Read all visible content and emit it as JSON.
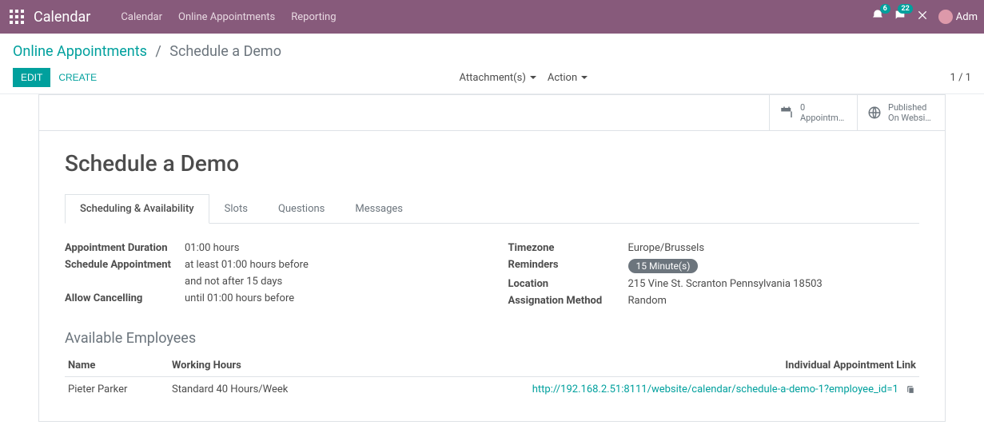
{
  "nav": {
    "brand": "Calendar",
    "links": [
      "Calendar",
      "Online Appointments",
      "Reporting"
    ],
    "notif_count1": "6",
    "notif_count2": "22",
    "user_name": "Adm"
  },
  "breadcrumb": {
    "parent": "Online Appointments",
    "current": "Schedule a Demo"
  },
  "buttons": {
    "edit": "Edit",
    "create": "Create",
    "attachments": "Attachment(s)",
    "action": "Action"
  },
  "pager": "1 / 1",
  "stat_buttons": {
    "appointments_count": "0",
    "appointments_label": "Appointme…",
    "published_label1": "Published",
    "published_label2": "On Websi…"
  },
  "form": {
    "title": "Schedule a Demo",
    "tabs": [
      "Scheduling & Availability",
      "Slots",
      "Questions",
      "Messages"
    ],
    "left": {
      "duration_label": "Appointment Duration",
      "duration_value": "01:00 hours",
      "schedule_label": "Schedule Appointment",
      "schedule_value1": "at least 01:00 hours before",
      "schedule_value2": "and not after 15 days",
      "cancel_label": "Allow Cancelling",
      "cancel_value": "until 01:00 hours before"
    },
    "right": {
      "timezone_label": "Timezone",
      "timezone_value": "Europe/Brussels",
      "reminders_label": "Reminders",
      "reminders_value": "15 Minute(s)",
      "location_label": "Location",
      "location_value": "215 Vine St. Scranton Pennsylvania 18503",
      "assignation_label": "Assignation Method",
      "assignation_value": "Random"
    },
    "employees": {
      "section_title": "Available Employees",
      "headers": {
        "name": "Name",
        "hours": "Working Hours",
        "link": "Individual Appointment Link"
      },
      "rows": [
        {
          "name": "Pieter Parker",
          "hours": "Standard 40 Hours/Week",
          "link": "http://192.168.2.51:8111/website/calendar/schedule-a-demo-1?employee_id=1"
        }
      ]
    }
  }
}
